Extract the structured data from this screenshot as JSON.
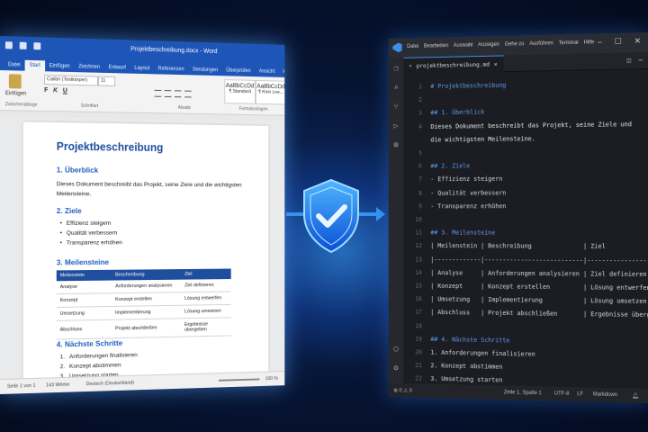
{
  "word": {
    "doc_title": "Projektbeschreibung.docx - Word",
    "tabs": [
      "Datei",
      "Start",
      "Einfügen",
      "Zeichnen",
      "Entwurf",
      "Layout",
      "Referenzen",
      "Sendungen",
      "Überprüfen",
      "Ansicht",
      "Hilfe"
    ],
    "ribbon": {
      "paste": "Einfügen",
      "clipboard": "Zwischenablage",
      "font_name": "Calibri (Textkörper)",
      "font_size": "11",
      "font_group": "Schriftart",
      "paragraph_group": "Absatz",
      "styles_group": "Formatvorlagen",
      "style_sample": "AaBbCcDd",
      "style1": "¶ Standard",
      "style2": "¶ Kein Lee...",
      "bold": "F",
      "italic": "K",
      "underline": "U"
    },
    "document": {
      "title": "Projektbeschreibung",
      "s1_heading": "1. Überblick",
      "s1_text": "Dieses Dokument beschreibt das Projekt, seine Ziele und die wichtigsten Meilensteine.",
      "s2_heading": "2. Ziele",
      "goals": [
        "Effizienz steigern",
        "Qualität verbessern",
        "Transparenz erhöhen"
      ],
      "s3_heading": "3. Meilensteine",
      "table_headers": [
        "Meilenstein",
        "Beschreibung",
        "Ziel"
      ],
      "table_rows": [
        [
          "Analyse",
          "Anforderungen analysieren",
          "Ziel definieren"
        ],
        [
          "Konzept",
          "Konzept erstellen",
          "Lösung entwerfen"
        ],
        [
          "Umsetzung",
          "Implementierung",
          "Lösung umsetzen"
        ],
        [
          "Abschluss",
          "Projekt abschließen",
          "Ergebnisse übergeben"
        ]
      ],
      "s4_heading": "4. Nächste Schritte",
      "steps": [
        "Anforderungen finalisieren",
        "Konzept abstimmen",
        "Umsetzung starten"
      ]
    },
    "status": {
      "page": "Seite 1 von 1",
      "words": "143 Wörter",
      "language": "Deutsch (Deutschland)",
      "zoom": "100 %"
    }
  },
  "vscode": {
    "menu": [
      "Datei",
      "Bearbeiten",
      "Auswahl",
      "Anzeigen",
      "Gehe zu",
      "Ausführen",
      "Terminal",
      "Hilfe"
    ],
    "tab": "projektbeschreibung.md",
    "lines": [
      {
        "n": "1",
        "t": "# Projektbeschreibung",
        "k": "h"
      },
      {
        "n": "2",
        "t": "",
        "k": ""
      },
      {
        "n": "3",
        "t": "## 1. Überblick",
        "k": "h"
      },
      {
        "n": "4",
        "t": "Dieses Dokument beschreibt das Projekt, seine Ziele und",
        "k": ""
      },
      {
        "n": "",
        "t": "die wichtigsten Meilensteine.",
        "k": ""
      },
      {
        "n": "5",
        "t": "",
        "k": ""
      },
      {
        "n": "6",
        "t": "## 2. Ziele",
        "k": "h"
      },
      {
        "n": "7",
        "t": "- Effizienz steigern",
        "k": "li"
      },
      {
        "n": "8",
        "t": "- Qualität verbessern",
        "k": "li"
      },
      {
        "n": "9",
        "t": "- Transparenz erhöhen",
        "k": "li"
      },
      {
        "n": "10",
        "t": "",
        "k": ""
      },
      {
        "n": "11",
        "t": "## 3. Meilensteine",
        "k": "h"
      },
      {
        "n": "12",
        "t": "| Meilenstein | Beschreibung              | Ziel             |",
        "k": "tb"
      },
      {
        "n": "13",
        "t": "|-------------|---------------------------|------------------|",
        "k": "tb"
      },
      {
        "n": "14",
        "t": "| Analyse     | Anforderungen analysieren | Ziel definieren  |",
        "k": "tb"
      },
      {
        "n": "15",
        "t": "| Konzept     | Konzept erstellen         | Lösung entwerfen |",
        "k": "tb"
      },
      {
        "n": "16",
        "t": "| Umsetzung   | Implementierung           | Lösung umsetzen  |",
        "k": "tb"
      },
      {
        "n": "17",
        "t": "| Abschluss   | Projekt abschließen       | Ergebnisse übergeben|",
        "k": "tb"
      },
      {
        "n": "18",
        "t": "",
        "k": ""
      },
      {
        "n": "19",
        "t": "## 4. Nächste Schritte",
        "k": "h"
      },
      {
        "n": "20",
        "t": "1. Anforderungen finalisieren",
        "k": "li"
      },
      {
        "n": "21",
        "t": "2. Konzept abstimmen",
        "k": "li"
      },
      {
        "n": "22",
        "t": "3. Umsetzung starten",
        "k": "li"
      }
    ],
    "status": {
      "position": "Zeile 1, Spalte 1",
      "encoding": "UTF-8",
      "eol": "LF",
      "language": "Markdown"
    }
  },
  "colors": {
    "word_blue": "#1e56b8",
    "heading_blue": "#1f4e9e",
    "md_heading": "#5c9cf0",
    "shield": "#3aa0ff"
  }
}
